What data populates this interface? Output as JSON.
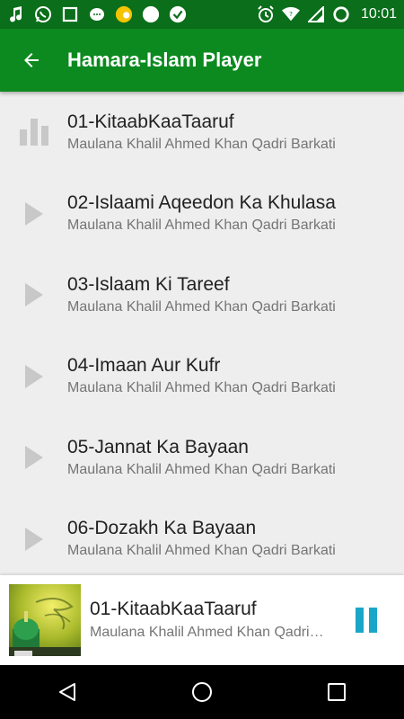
{
  "status_bar": {
    "time": "10:01",
    "color": "#0a6e1a",
    "left_icons": [
      "music-note-icon",
      "whatsapp-icon",
      "square-icon",
      "chat-bubble-icon",
      "weather-icon",
      "circle-icon",
      "check-badge-icon"
    ],
    "right_icons": [
      "alarm-icon",
      "wifi-icon",
      "cell-signal-icon",
      "battery-icon"
    ]
  },
  "app_bar": {
    "title": "Hamara-Islam Player",
    "color": "#0c8a1f"
  },
  "tracks": [
    {
      "title": "01-KitaabKaaTaaruf",
      "artist": "Maulana Khalil Ahmed Khan Qadri Barkati",
      "state": "playing"
    },
    {
      "title": "02-Islaami Aqeedon Ka Khulasa",
      "artist": "Maulana Khalil Ahmed Khan Qadri Barkati",
      "state": "idle"
    },
    {
      "title": "03-Islaam Ki Tareef",
      "artist": "Maulana Khalil Ahmed Khan Qadri Barkati",
      "state": "idle"
    },
    {
      "title": "04-Imaan Aur Kufr",
      "artist": "Maulana Khalil Ahmed Khan Qadri Barkati",
      "state": "idle"
    },
    {
      "title": "05-Jannat Ka Bayaan",
      "artist": "Maulana Khalil Ahmed Khan Qadri Barkati",
      "state": "idle"
    },
    {
      "title": "06-Dozakh Ka Bayaan",
      "artist": "Maulana Khalil Ahmed Khan Qadri Barkati",
      "state": "idle"
    }
  ],
  "mini_player": {
    "title": "01-KitaabKaaTaaruf",
    "artist": "Maulana Khalil Ahmed Khan Qadri…",
    "accent": "#1aa6c8"
  },
  "nav_bar": {
    "buttons": [
      "back-triangle-icon",
      "home-circle-icon",
      "recents-square-icon"
    ]
  }
}
